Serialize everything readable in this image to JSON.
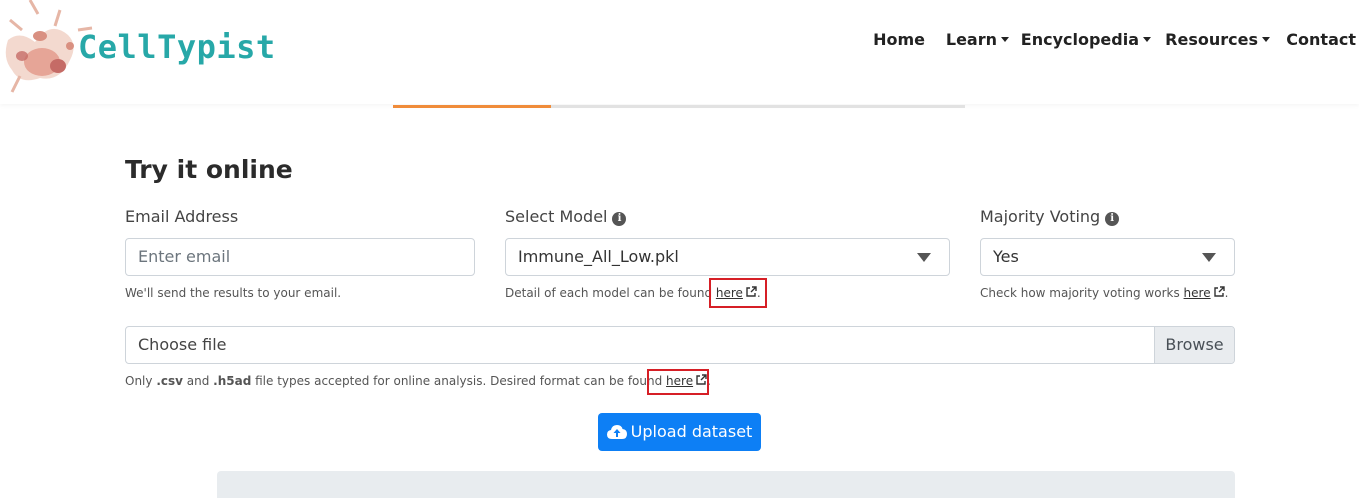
{
  "brand": {
    "name": "CellTypist"
  },
  "nav": {
    "home": "Home",
    "learn": "Learn",
    "encyclopedia": "Encyclopedia",
    "resources": "Resources",
    "contact": "Contact"
  },
  "form": {
    "title": "Try it online",
    "email": {
      "label": "Email Address",
      "placeholder": "Enter email",
      "help": "We'll send the results to your email."
    },
    "model": {
      "label": "Select Model",
      "value": "Immune_All_Low.pkl",
      "help": "Detail of each model can be found ",
      "link": "here",
      "suffix": "."
    },
    "voting": {
      "label": "Majority Voting",
      "value": "Yes",
      "help": "Check how majority voting works ",
      "link": "here",
      "suffix": "."
    },
    "file": {
      "placeholder": "Choose file",
      "browse": "Browse",
      "help_prefix": "Only ",
      "ext1": ".csv",
      "and": " and ",
      "ext2": ".h5ad",
      "help_rest": " file types accepted for online analysis. Desired format can be found ",
      "link": "here",
      "suffix": "."
    },
    "upload": "Upload dataset"
  },
  "colors": {
    "accent": "#0d7ff5",
    "brand": "#27a8a8",
    "tab_active": "#f08c3a",
    "highlight": "#d61f26"
  }
}
